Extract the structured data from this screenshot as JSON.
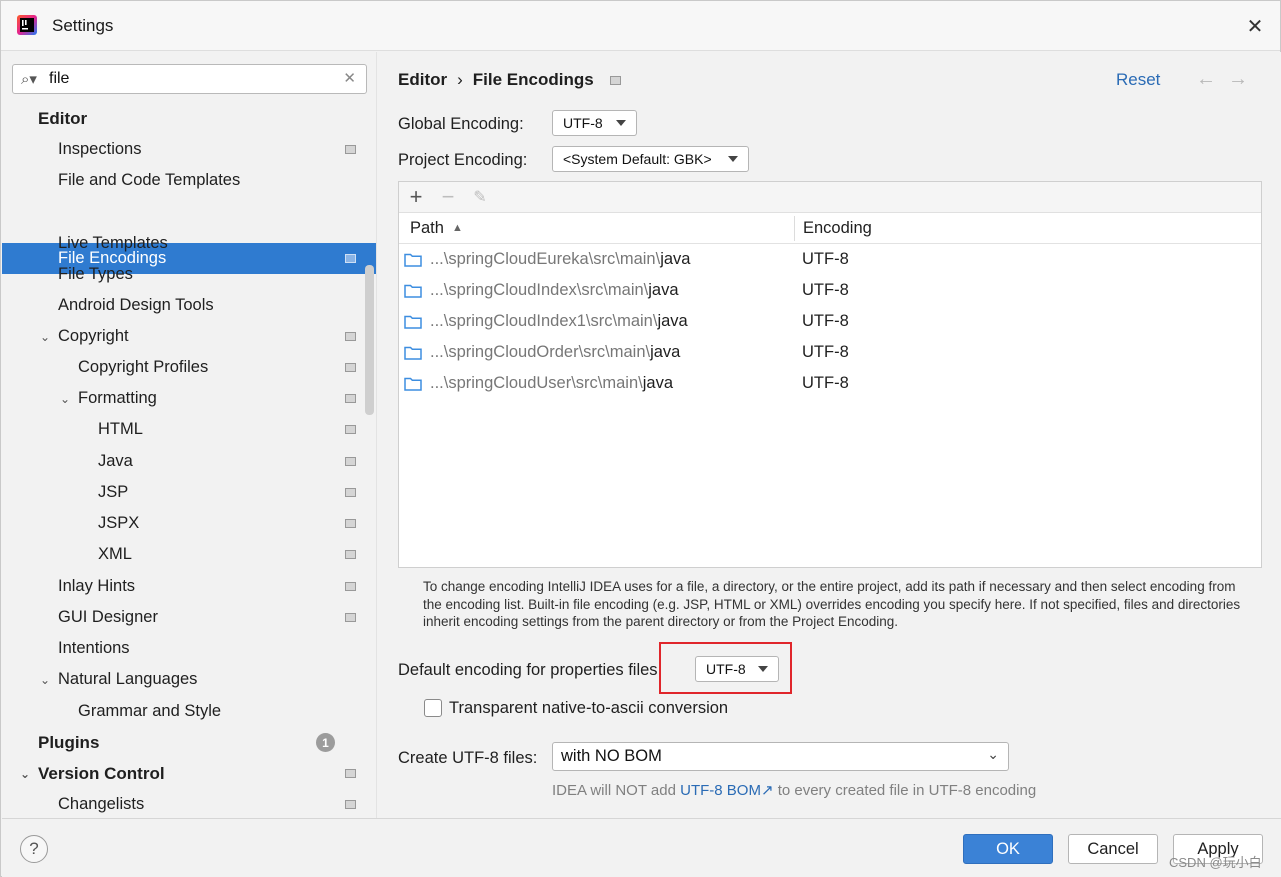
{
  "window": {
    "title": "Settings"
  },
  "search": {
    "value": "file"
  },
  "sidebar": {
    "items": [
      {
        "label": "Editor"
      },
      {
        "label": "Inspections"
      },
      {
        "label": "File and Code Templates"
      },
      {
        "label": "File Encodings"
      },
      {
        "label": "Live Templates"
      },
      {
        "label": "File Types"
      },
      {
        "label": "Android Design Tools"
      },
      {
        "label": "Copyright"
      },
      {
        "label": "Copyright Profiles"
      },
      {
        "label": "Formatting"
      },
      {
        "label": "HTML"
      },
      {
        "label": "Java"
      },
      {
        "label": "JSP"
      },
      {
        "label": "JSPX"
      },
      {
        "label": "XML"
      },
      {
        "label": "Inlay Hints"
      },
      {
        "label": "GUI Designer"
      },
      {
        "label": "Intentions"
      },
      {
        "label": "Natural Languages"
      },
      {
        "label": "Grammar and Style"
      },
      {
        "label": "Plugins",
        "badge": "1"
      },
      {
        "label": "Version Control"
      },
      {
        "label": "Changelists"
      }
    ]
  },
  "main": {
    "breadcrumb": {
      "parent": "Editor",
      "separator": "›",
      "current": "File Encodings"
    },
    "reset_label": "Reset",
    "global_encoding": {
      "label": "Global Encoding:",
      "value": "UTF-8"
    },
    "project_encoding": {
      "label": "Project Encoding:",
      "value": "<System Default: GBK>"
    },
    "table": {
      "columns": {
        "path": "Path",
        "encoding": "Encoding"
      },
      "rows": [
        {
          "prefix": "...\\springCloudEureka\\src\\main\\",
          "leaf": "java",
          "encoding": "UTF-8"
        },
        {
          "prefix": "...\\springCloudIndex\\src\\main\\",
          "leaf": "java",
          "encoding": "UTF-8"
        },
        {
          "prefix": "...\\springCloudIndex1\\src\\main\\",
          "leaf": "java",
          "encoding": "UTF-8"
        },
        {
          "prefix": "...\\springCloudOrder\\src\\main\\",
          "leaf": "java",
          "encoding": "UTF-8"
        },
        {
          "prefix": "...\\springCloudUser\\src\\main\\",
          "leaf": "java",
          "encoding": "UTF-8"
        }
      ]
    },
    "description": "To change encoding IntelliJ IDEA uses for a file, a directory, or the entire project, add its path if necessary and then select encoding from the encoding list. Built-in file encoding (e.g. JSP, HTML or XML) overrides encoding you specify here. If not specified, files and directories inherit encoding settings from the parent directory or from the Project Encoding.",
    "properties_encoding": {
      "label": "Default encoding for properties files:",
      "value": "UTF-8"
    },
    "native_to_ascii": {
      "label": "Transparent native-to-ascii conversion",
      "checked": false
    },
    "create_utf8": {
      "label": "Create UTF-8 files:",
      "value": "with NO BOM"
    },
    "hint": {
      "before": "IDEA will NOT add ",
      "link": "UTF-8 BOM",
      "link_arrow": "↗",
      "after": " to every created file in UTF-8 encoding"
    }
  },
  "footer": {
    "help_label": "?",
    "ok_label": "OK",
    "cancel_label": "Cancel",
    "apply_label": "Apply",
    "watermark": "CSDN @玩小白"
  },
  "colors": {
    "accent": "#2f7bd0",
    "link": "#2a6bb5",
    "highlight": "#e0262b"
  }
}
